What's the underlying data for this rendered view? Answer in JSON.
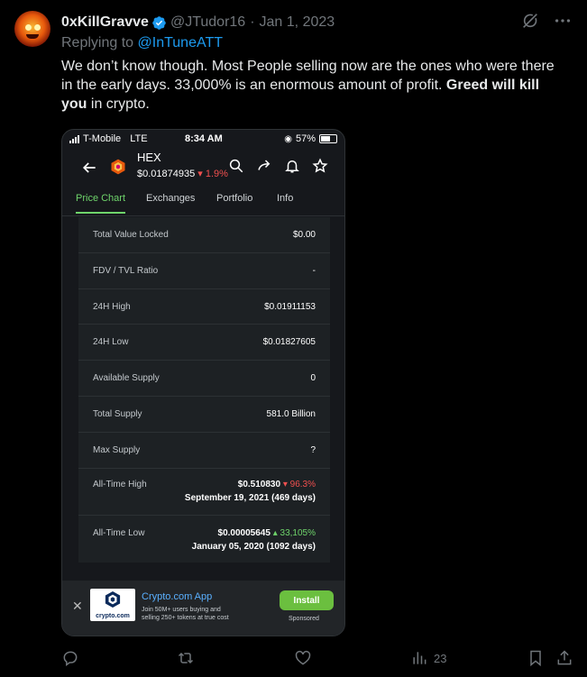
{
  "tweet": {
    "display_name": "0xKillGravve",
    "handle": "@JTudor16",
    "separator": "·",
    "date": "Jan 1, 2023",
    "reply_prefix": "Replying to",
    "reply_to": "@InTuneATT",
    "text_part1": "We don’t know though. Most People selling now are the ones who were there in the early days. 33,000% is an enormous amount of profit.",
    "text_bold": "Greed will kill you",
    "text_part2": "in crypto.",
    "views_count": "23"
  },
  "phone": {
    "carrier": "T-Mobile",
    "network": "LTE",
    "time": "8:34 AM",
    "battery": "57%",
    "coin_name": "HEX",
    "coin_price": "$0.01874935",
    "coin_change": "▾ 1.9%",
    "tabs": [
      "Price Chart",
      "Exchanges",
      "Portfolio",
      "Info"
    ],
    "active_tab": "Price Chart",
    "stats": [
      {
        "label": "Total Value Locked",
        "value": "$0.00"
      },
      {
        "label": "FDV / TVL Ratio",
        "value": "-"
      },
      {
        "label": "24H High",
        "value": "$0.01911153"
      },
      {
        "label": "24H Low",
        "value": "$0.01827605"
      },
      {
        "label": "Available Supply",
        "value": "0"
      },
      {
        "label": "Total Supply",
        "value": "581.0 Billion"
      },
      {
        "label": "Max Supply",
        "value": "?"
      }
    ],
    "ath": {
      "label": "All-Time High",
      "value": "$0.510830",
      "change": "▾ 96.3%",
      "date": "September 19, 2021 (469 days)"
    },
    "atl": {
      "label": "All-Time Low",
      "value": "$0.00005645",
      "change": "▴ 33,105%",
      "date": "January 05, 2020 (1092 days)"
    },
    "ad": {
      "close": "✕",
      "logo_text": "crypto.com",
      "brand": "Crypto.com App",
      "description": "Join 50M+ users buying and selling 250+ tokens at true cost",
      "install": "Install",
      "sponsored": "Sponsored"
    }
  },
  "colors": {
    "accent_blue": "#1d9bf0",
    "muted": "#71767b",
    "up_green": "#6fd46b",
    "down_red": "#f0504f",
    "install_green": "#6bbf3f"
  },
  "icons": [
    "verified-badge-icon",
    "grok-icon",
    "more-icon",
    "reply-icon",
    "retweet-icon",
    "like-icon",
    "views-icon",
    "bookmark-icon",
    "share-icon"
  ]
}
